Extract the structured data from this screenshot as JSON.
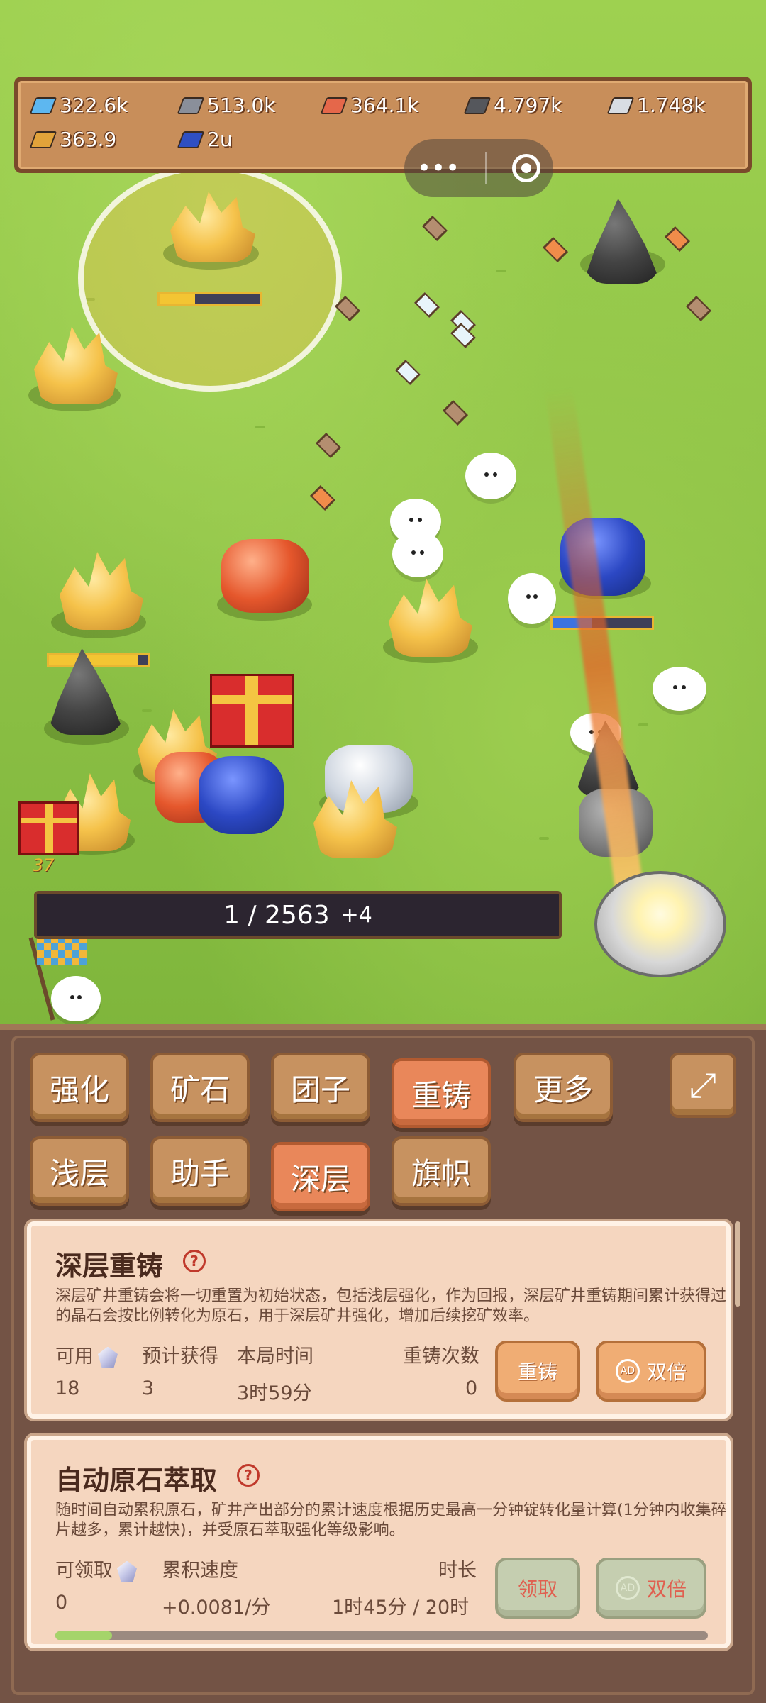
{
  "resources": [
    {
      "name": "crystal",
      "value": "322.6k",
      "color": "#5db7f0"
    },
    {
      "name": "iron",
      "value": "513.0k",
      "color": "#8a8f9a"
    },
    {
      "name": "copper",
      "value": "364.1k",
      "color": "#e5674a"
    },
    {
      "name": "coal",
      "value": "4.797k",
      "color": "#55575c"
    },
    {
      "name": "silver",
      "value": "1.748k",
      "color": "#d8dde3"
    },
    {
      "name": "gold",
      "value": "363.9",
      "color": "#e2a33a"
    },
    {
      "name": "sapphire",
      "value": "2u",
      "color": "#2f4fc2"
    }
  ],
  "mini_program": {
    "menu_icon": "more-dots-icon",
    "close_icon": "target-icon"
  },
  "field": {
    "counter": "1 / 2563",
    "counter_inc": "+4",
    "gift_count": "37",
    "progress_levels": {
      "top_left_gold": 0.35,
      "lapis": 0.4,
      "left_gold": 0.9
    }
  },
  "tabs_row1": [
    "强化",
    "矿石",
    "团子",
    "重铸",
    "更多"
  ],
  "tabs_row2": [
    "浅层",
    "助手",
    "深层",
    "旗帜"
  ],
  "active_tab_row1": "重铸",
  "active_tab_row2": "深层",
  "deep_recast": {
    "title": "深层重铸",
    "help": "?",
    "desc": "深层矿井重铸会将一切重置为初始状态，包括浅层强化，作为回报，深层矿井重铸期间累计获得过的晶石会按比例转化为原石，用于深层矿井强化，增加后续挖矿效率。",
    "labels": {
      "available": "可用",
      "expected": "预计获得",
      "round_time": "本局时间",
      "recast_count": "重铸次数"
    },
    "values": {
      "available": "18",
      "expected": "3",
      "round_time": "3时59分",
      "recast_count": "0"
    },
    "buttons": {
      "recast": "重铸",
      "double": "双倍",
      "ad": "AD"
    }
  },
  "auto_extract": {
    "title": "自动原石萃取",
    "help": "?",
    "desc": "随时间自动累积原石，矿井产出部分的累计速度根据历史最高一分钟锭转化量计算(1分钟内收集碎片越多，累计越快)，并受原石萃取强化等级影响。",
    "labels": {
      "claimable": "可领取",
      "speed": "累积速度",
      "duration": "时长"
    },
    "values": {
      "claimable": "0",
      "speed": "+0.0081/分",
      "duration": "1时45分 / 20时"
    },
    "progress": 0.087,
    "buttons": {
      "claim": "领取",
      "double": "双倍",
      "ad": "AD"
    }
  }
}
